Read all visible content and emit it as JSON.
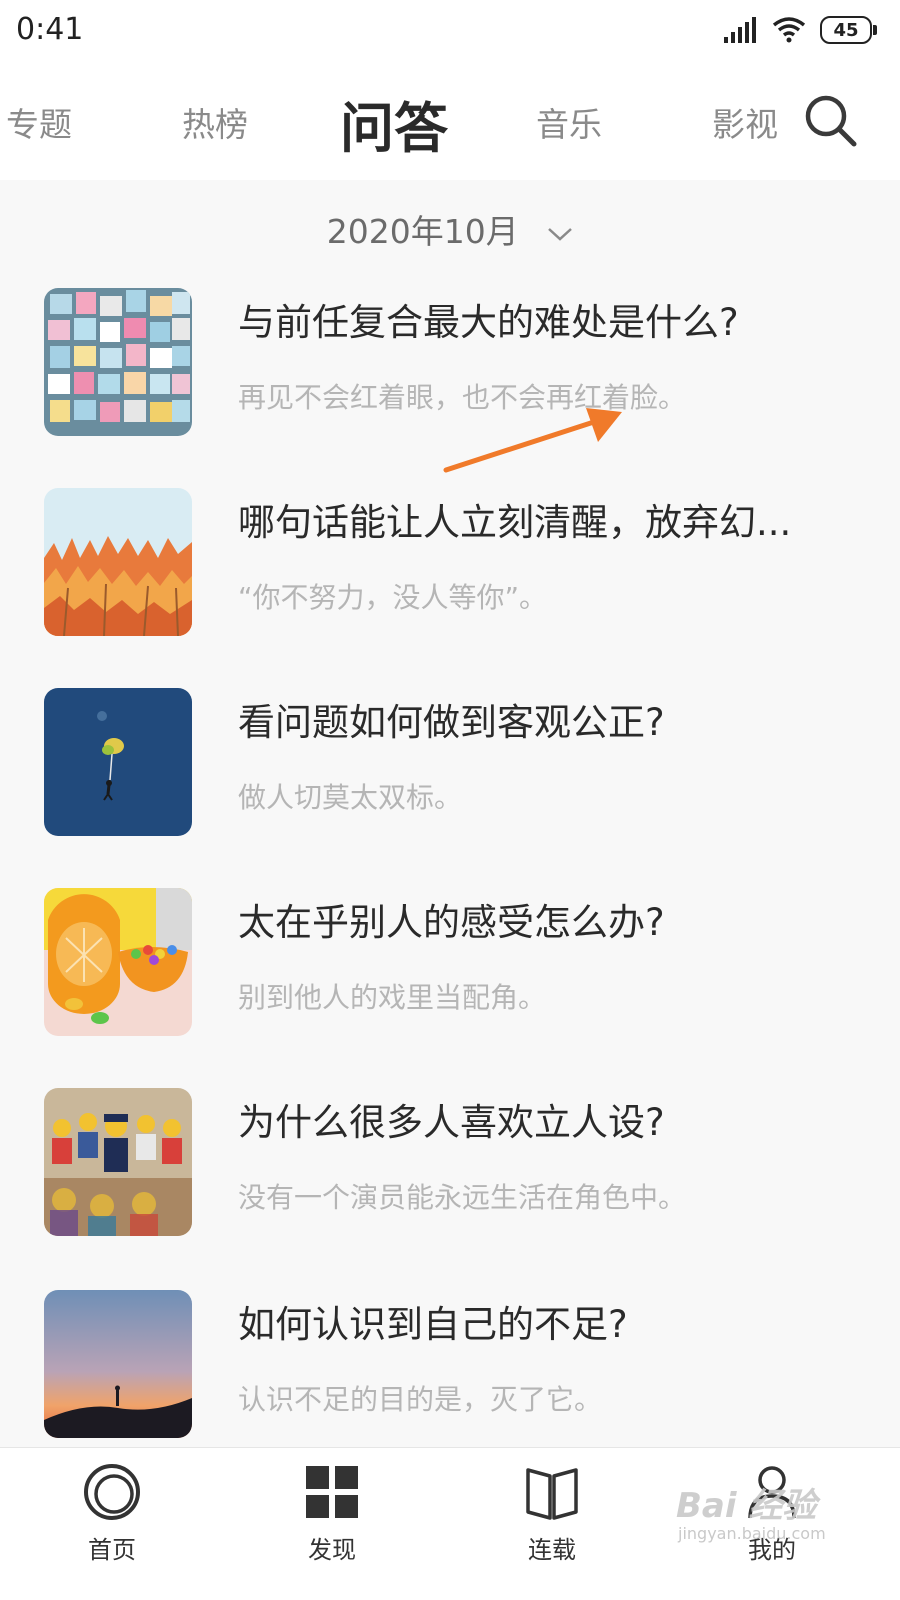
{
  "status": {
    "time": "0:41",
    "battery": "45"
  },
  "tabs": [
    {
      "label": "专题"
    },
    {
      "label": "热榜"
    },
    {
      "label": "问答"
    },
    {
      "label": "音乐"
    },
    {
      "label": "影视"
    }
  ],
  "month": {
    "label": "2020年10月"
  },
  "items": [
    {
      "title": "与前任复合最大的难处是什么?",
      "subtitle": "再见不会红着眼，也不会再红着脸。"
    },
    {
      "title": "哪句话能让人立刻清醒，放弃幻...",
      "subtitle": "“你不努力，没人等你”。"
    },
    {
      "title": "看问题如何做到客观公正?",
      "subtitle": "做人切莫太双标。"
    },
    {
      "title": "太在乎别人的感受怎么办?",
      "subtitle": "别到他人的戏里当配角。"
    },
    {
      "title": "为什么很多人喜欢立人设?",
      "subtitle": "没有一个演员能永远生活在角色中。"
    },
    {
      "title": "如何认识到自己的不足?",
      "subtitle": "认识不足的目的是，灭了它。"
    }
  ],
  "nav": [
    {
      "label": "首页"
    },
    {
      "label": "发现"
    },
    {
      "label": "连载"
    },
    {
      "label": "我的"
    }
  ],
  "watermark": {
    "text": "Bai 经验",
    "sub": "jingyan.baidu.com"
  },
  "colors": {
    "arrow": "#f07a2a",
    "active_tab": "#2a2a2a",
    "inactive_tab": "#8a8a8a"
  }
}
